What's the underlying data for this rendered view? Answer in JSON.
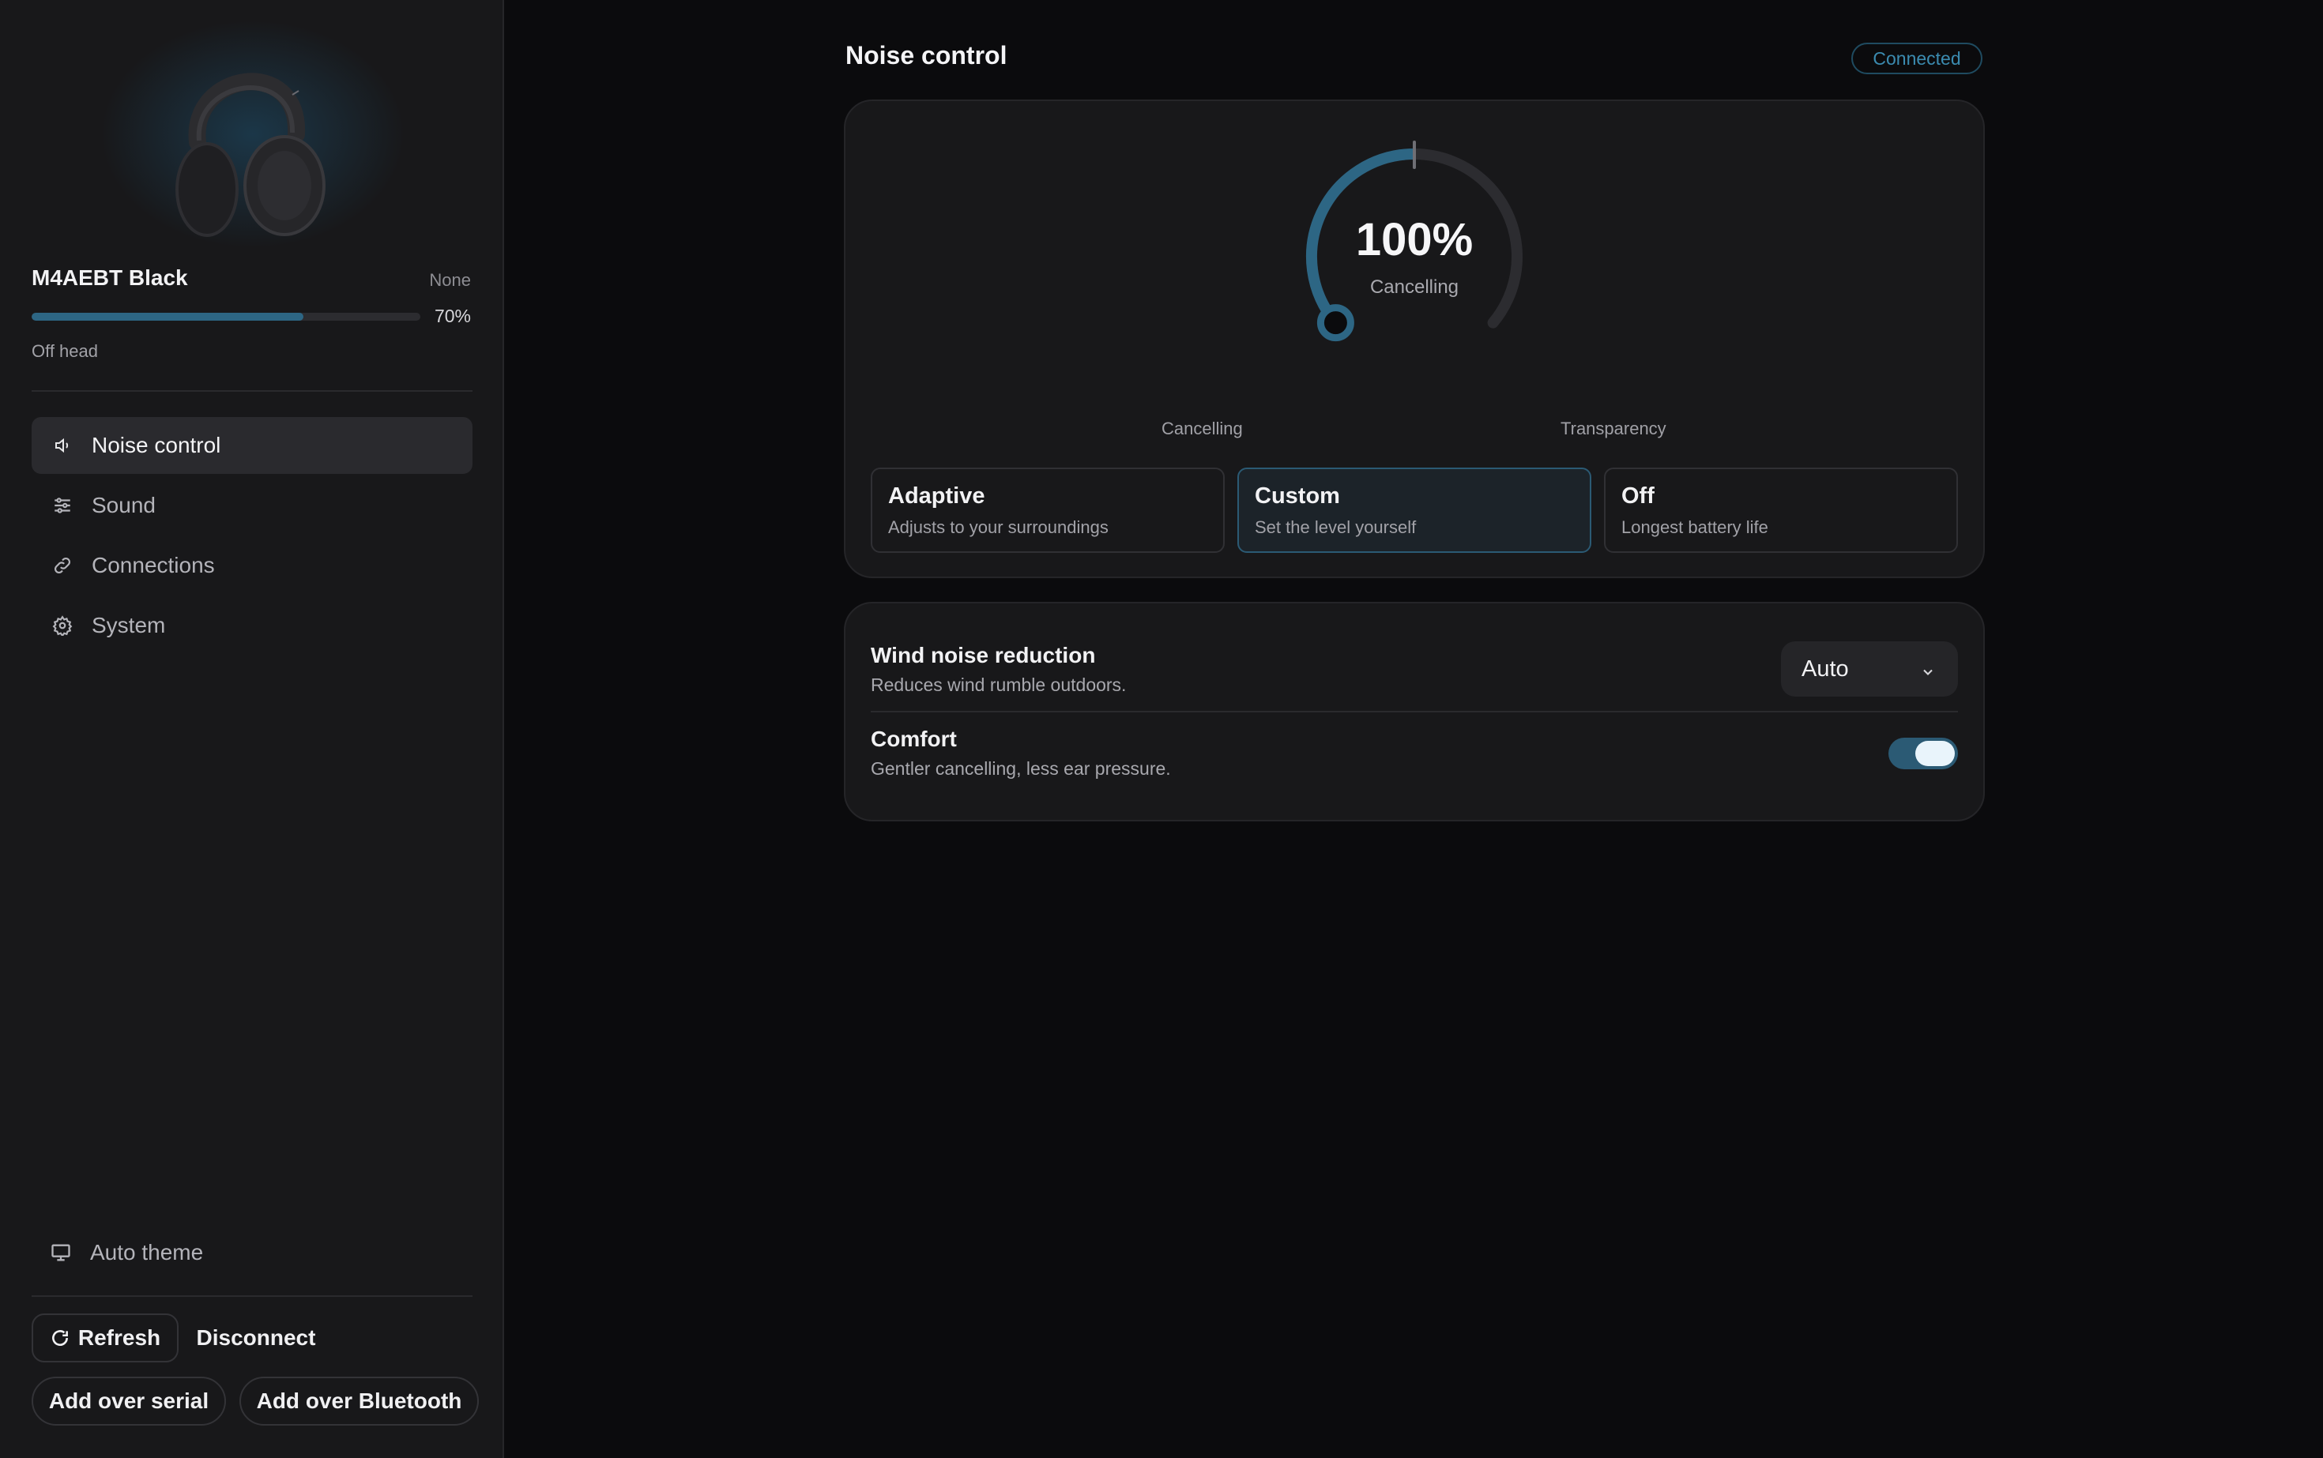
{
  "device": {
    "name": "M4AEBT Black",
    "status_right": "None",
    "battery_level": 0.7,
    "battery_label": "70%",
    "wear_state": "Off head"
  },
  "nav": {
    "items": [
      {
        "label": "Noise control",
        "icon": "speaker-icon",
        "active": true
      },
      {
        "label": "Sound",
        "icon": "sliders-icon",
        "active": false
      },
      {
        "label": "Connections",
        "icon": "link-icon",
        "active": false
      },
      {
        "label": "System",
        "icon": "gear-icon",
        "active": false
      }
    ]
  },
  "footer": {
    "theme_label": "Auto theme",
    "refresh_label": "Refresh",
    "disconnect_label": "Disconnect",
    "add_serial_label": "Add over serial",
    "add_bluetooth_label": "Add over Bluetooth"
  },
  "header": {
    "title": "Noise control",
    "status": "Connected"
  },
  "anc": {
    "value_label": "100%",
    "value": 100,
    "mode_label": "Cancelling",
    "scale_left": "Cancelling",
    "scale_right": "Transparency",
    "modes": [
      {
        "title": "Adaptive",
        "desc": "Adjusts to your surroundings",
        "selected": false
      },
      {
        "title": "Custom",
        "desc": "Set the level yourself",
        "selected": true
      },
      {
        "title": "Off",
        "desc": "Longest battery life",
        "selected": false
      }
    ]
  },
  "options": {
    "wind": {
      "title": "Wind noise reduction",
      "desc": "Reduces wind rumble outdoors.",
      "value": "Auto"
    },
    "comfort": {
      "title": "Comfort",
      "desc": "Gentler cancelling, less ear pressure.",
      "enabled": true
    }
  },
  "colors": {
    "accent": "#2d6684",
    "background": "#0b0b0d",
    "panel": "#18181a",
    "status_text": "#3b8bb0"
  }
}
